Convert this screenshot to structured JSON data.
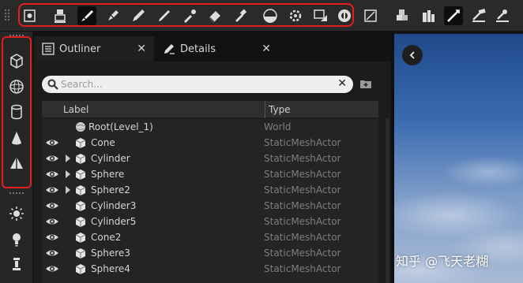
{
  "toolbar": {
    "buttons": [
      "select-mode",
      "place-mode",
      "paint-mode",
      "landscape-brush",
      "foliage-brush",
      "brush-small",
      "eyedropper",
      "eraser",
      "dropper-tool",
      "sphere-tool",
      "gear-tool",
      "snap-tool",
      "settings-tool",
      "scale-tool",
      "cubes-tool",
      "bottles-tool",
      "pencil-tool",
      "hammer-tool",
      "pen-tool"
    ]
  },
  "left_toolbar": {
    "items": [
      "cube-icon",
      "sphere-icon",
      "cylinder-icon",
      "cone-icon",
      "pyramid-icon",
      "sun-icon",
      "bulb-icon",
      "lamp-icon"
    ]
  },
  "tabs": [
    {
      "label": "Outliner"
    },
    {
      "label": "Details"
    }
  ],
  "search": {
    "placeholder": "Search...",
    "value": ""
  },
  "columns": {
    "label": "Label",
    "type": "Type"
  },
  "root": {
    "label": "Root(Level_1)",
    "type": "World"
  },
  "rows": [
    {
      "label": "Cone",
      "type": "StaticMeshActor",
      "expandable": false
    },
    {
      "label": "Cylinder",
      "type": "StaticMeshActor",
      "expandable": true
    },
    {
      "label": "Sphere",
      "type": "StaticMeshActor",
      "expandable": true
    },
    {
      "label": "Sphere2",
      "type": "StaticMeshActor",
      "expandable": true
    },
    {
      "label": "Cylinder3",
      "type": "StaticMeshActor",
      "expandable": false
    },
    {
      "label": "Cylinder5",
      "type": "StaticMeshActor",
      "expandable": false
    },
    {
      "label": "Cone2",
      "type": "StaticMeshActor",
      "expandable": false
    },
    {
      "label": "Sphere3",
      "type": "StaticMeshActor",
      "expandable": false
    },
    {
      "label": "Sphere4",
      "type": "StaticMeshActor",
      "expandable": false
    }
  ],
  "viewport": {
    "watermark": "知乎 @飞天老糊"
  },
  "colors": {
    "highlight": "#e21d1d",
    "panel_bg": "#1c1c1c",
    "text": "#d4d4d4",
    "type_text": "#7e7e7e"
  }
}
